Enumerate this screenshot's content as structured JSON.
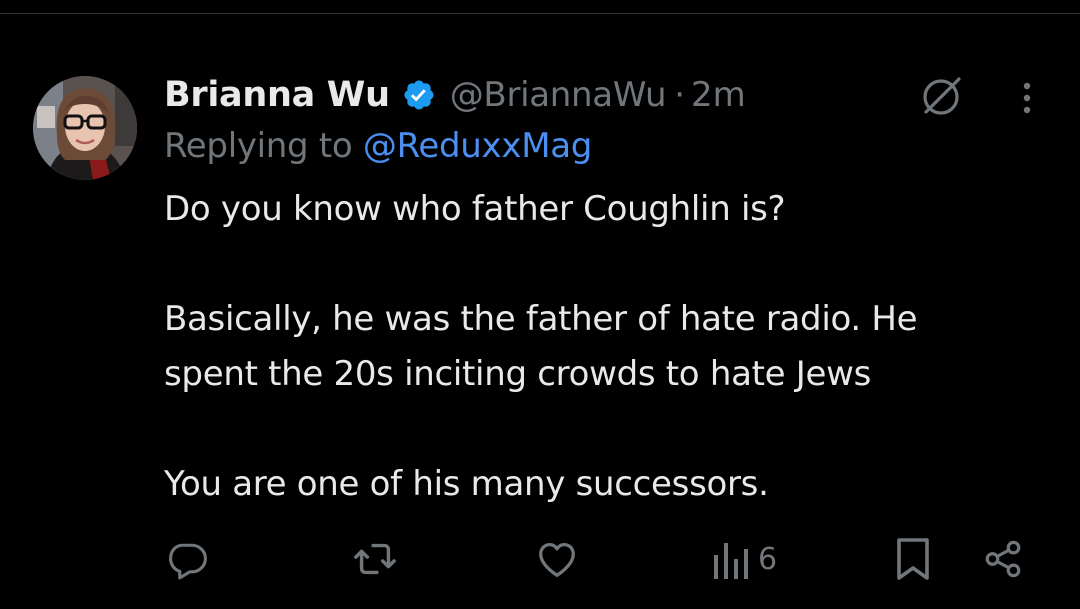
{
  "tweet": {
    "author": {
      "display_name": "Brianna Wu",
      "handle": "@BriannaWu",
      "verified": true,
      "avatar": "profile-photo"
    },
    "separator": "·",
    "time": "2m",
    "reply_prefix": "Replying to",
    "reply_to": "@ReduxxMag",
    "body": {
      "p1": "Do you know who father Coughlin is?",
      "p2_line1": "Basically, he was the father of hate radio. He",
      "p2_line2": "spent the 20s inciting crowds to hate Jews",
      "p3": "You are one of his many successors."
    },
    "actions": {
      "reply_icon": "reply-icon",
      "retweet_icon": "retweet-icon",
      "like_icon": "heart-icon",
      "views_icon": "views-icon",
      "views_count": "6",
      "bookmark_icon": "bookmark-icon",
      "share_icon": "share-icon"
    },
    "header_icons": {
      "grok": "grok-icon",
      "more": "more-icon"
    }
  },
  "colors": {
    "background": "#000000",
    "text_primary": "#e7e9ea",
    "text_secondary": "#71767b",
    "link": "#4b8ff0",
    "verified": "#1d9bf0",
    "divider": "#2f3336"
  }
}
